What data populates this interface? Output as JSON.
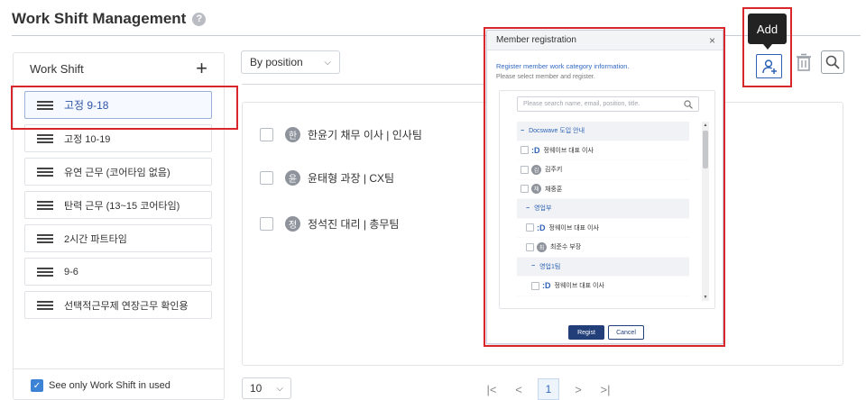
{
  "header": {
    "title": "Work Shift Management",
    "help_icon": "?"
  },
  "shift_panel": {
    "title": "Work Shift",
    "add_label": "+",
    "items": [
      {
        "label": "고정 9-18",
        "selected": true
      },
      {
        "label": "고정 10-19"
      },
      {
        "label": "유연 근무 (코어타임 없음)"
      },
      {
        "label": "탄력 근무 (13~15 코어타임)"
      },
      {
        "label": "2시간 파트타임"
      },
      {
        "label": "9-6"
      },
      {
        "label": "선택적근무제 연장근무 확인용"
      }
    ],
    "footer_check": "✓",
    "footer_label": "See only Work Shift in used"
  },
  "main": {
    "position_select": "By position",
    "members": [
      {
        "avatar": "한",
        "name": "한윤기 채무 이사 | 인사팀"
      },
      {
        "avatar": "윤",
        "name": "윤태형 과장 | CX팀"
      },
      {
        "avatar": "정",
        "name": "정석진 대리 | 총무팀"
      }
    ],
    "page_size": "10",
    "pager": {
      "first": "|<",
      "prev": "<",
      "current": "1",
      "next": ">",
      "last": ">|"
    }
  },
  "toolbar": {
    "add_tooltip": "Add"
  },
  "modal": {
    "title": "Member registration",
    "close": "×",
    "description": "Register member work category information.",
    "subdescription": "Please select member and register.",
    "search_placeholder": "Please search name, email, position, title.",
    "tree": [
      {
        "type": "group",
        "label": "Docswave 도입 안내",
        "indent": 0
      },
      {
        "type": "user",
        "logo": ":D",
        "label": "정웨이브 대표 이사",
        "indent": 0
      },
      {
        "type": "user",
        "avatar": "김",
        "label": "김주키",
        "indent": 0
      },
      {
        "type": "user",
        "avatar": "채",
        "label": "채중훈",
        "indent": 0
      },
      {
        "type": "group",
        "label": "영업부",
        "indent": 1
      },
      {
        "type": "user",
        "logo": ":D",
        "label": "정웨이브 대표 이사",
        "indent": 1
      },
      {
        "type": "user",
        "avatar": "최",
        "label": "최준수 부장",
        "indent": 1
      },
      {
        "type": "group",
        "label": "영업1팀",
        "indent": 2
      },
      {
        "type": "user",
        "logo": ":D",
        "label": "정웨이브 대표 이사",
        "indent": 2
      }
    ],
    "regist_label": "Regist",
    "cancel_label": "Cancel"
  },
  "colors": {
    "accent": "#2d62b5",
    "highlight": "#d8262b"
  }
}
